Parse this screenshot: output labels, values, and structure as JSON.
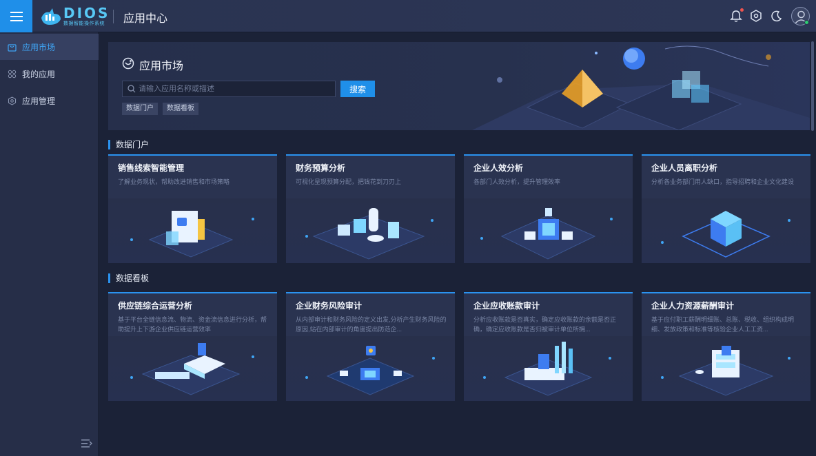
{
  "header": {
    "logo_text": "DIOS",
    "logo_sub": "数据智能操作系统",
    "title": "应用中心"
  },
  "sidebar": {
    "items": [
      {
        "label": "应用市场",
        "icon": "store-icon",
        "active": true
      },
      {
        "label": "我的应用",
        "icon": "grid-icon",
        "active": false
      },
      {
        "label": "应用管理",
        "icon": "gear-icon",
        "active": false
      }
    ]
  },
  "hero": {
    "title": "应用市场",
    "search_placeholder": "请输入应用名称或描述",
    "search_button": "搜索",
    "tags": [
      "数据门户",
      "数据看板"
    ]
  },
  "sections": [
    {
      "title": "数据门户",
      "cards": [
        {
          "title": "销售线索智能管理",
          "desc": "了解业务现状，帮助改进销售和市场策略"
        },
        {
          "title": "财务预算分析",
          "desc": "可视化呈现预算分配，把钱花到刀刃上"
        },
        {
          "title": "企业人效分析",
          "desc": "各部门人效分析，提升管理效率"
        },
        {
          "title": "企业人员离职分析",
          "desc": "分析各业务部门用人缺口，指导招聘和企业文化建设"
        }
      ]
    },
    {
      "title": "数据看板",
      "cards": [
        {
          "title": "供应链综合运营分析",
          "desc": "基于平台全链信息流、物流、资金流信息进行分析，帮助提升上下游企业供应链运营效率"
        },
        {
          "title": "企业财务风险审计",
          "desc": "从内部审计和财务风险的定义出发,分析产生财务风险的原因,站在内部审计的角度提出防范企..."
        },
        {
          "title": "企业应收账款审计",
          "desc": "分析应收账款是否真实，确定应收账款的余额是否正确，确定应收账款是否归被审计单位所拥..."
        },
        {
          "title": "企业人力资源薪酬审计",
          "desc": "基于应付职工薪酬明细账、总账、税收、组织构成明细、发放政策和标准等核验企业人工工资..."
        }
      ]
    }
  ],
  "colors": {
    "accent": "#1f8fe9",
    "card_bg": "#2a3350",
    "page_bg": "#1b2237"
  }
}
